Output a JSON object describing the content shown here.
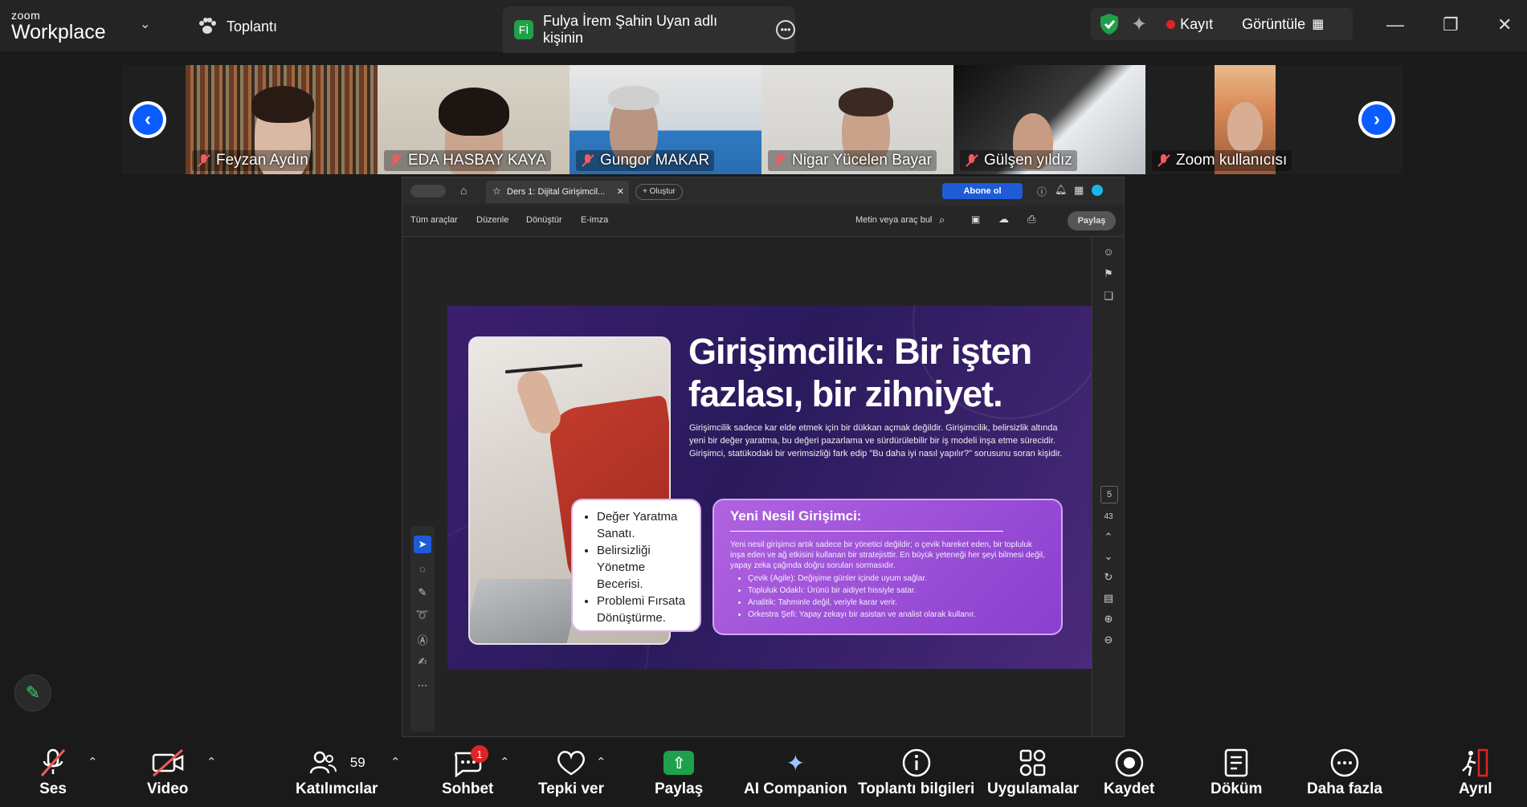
{
  "app": {
    "logo_small": "zoom",
    "logo_big": "Workplace"
  },
  "meeting": {
    "label": "Toplantı"
  },
  "share_tab": {
    "badge": "Fİ",
    "label": "Fulya İrem Şahin Uyan adlı kişinin"
  },
  "controls": {
    "record": "Kayıt",
    "view": "Görüntüle"
  },
  "participants": [
    {
      "name": "Feyzan Aydın"
    },
    {
      "name": "EDA HASBAY KAYA"
    },
    {
      "name": "Gungor MAKAR"
    },
    {
      "name": "Nigar Yücelen Bayar"
    },
    {
      "name": "Gülşen yıldız"
    },
    {
      "name": "Zoom kullanıcısı"
    }
  ],
  "acrobat": {
    "tab_title": "Ders 1: Dijital Girişimcil...",
    "create": "Oluştur",
    "subscribe": "Abone ol",
    "tools": [
      "Tüm araçlar",
      "Düzenle",
      "Dönüştür",
      "E-imza"
    ],
    "search": "Metin veya araç bul",
    "share": "Paylaş",
    "page_current": "5",
    "page_total": "43"
  },
  "slide": {
    "title": "Girişimcilik: Bir işten fazlası, bir zihniyet.",
    "paragraph": "Girişimcilik sadece kar elde etmek için bir dükkan açmak değildir. Girişimcilik, belirsizlik altında yeni bir değer yaratma, bu değeri pazarlama ve sürdürülebilir bir iş modeli inşa etme sürecidir. Girişimci, statükodaki bir verimsizliği fark edip \"Bu daha iyi nasıl yapılır?\" sorusunu soran kişidir.",
    "bullets": [
      "Değer Yaratma Sanatı.",
      "Belirsizliği Yönetme Becerisi.",
      "Problemi Fırsata Dönüştürme."
    ],
    "box_title": "Yeni Nesil Girişimci:",
    "box_text": "Yeni nesil girişimci artık sadece bir yönetici değildir; o çevik hareket eden, bir topluluk inşa eden ve ağ etkisini kullanan bir stratejisttir. En büyük yeteneği her şeyi bilmesi değil, yapay zeka çağında doğru soruları sormasıdır.",
    "box_bullets": [
      "Çevik (Agile): Değişime günler içinde uyum sağlar.",
      "Topluluk Odaklı: Ürünü bir aidiyet hissiyle satar.",
      "Analitik: Tahminle değil, veriyle karar verir.",
      "Orkestra Şefi: Yapay zekayı bir asistan ve analist olarak kullanır."
    ]
  },
  "toolbar": {
    "audio": "Ses",
    "video": "Video",
    "participants": "Katılımcılar",
    "participants_count": "59",
    "chat": "Sohbet",
    "chat_badge": "1",
    "react": "Tepki ver",
    "share": "Paylaş",
    "ai": "AI Companion",
    "info": "Toplantı bilgileri",
    "apps": "Uygulamalar",
    "record": "Kaydet",
    "transcript": "Döküm",
    "more": "Daha fazla",
    "leave": "Ayrıl"
  },
  "colors": {
    "accent": "#0b5cff",
    "share_green": "#1fa04a",
    "record_red": "#e02424",
    "muted_red": "#f15b5b"
  }
}
